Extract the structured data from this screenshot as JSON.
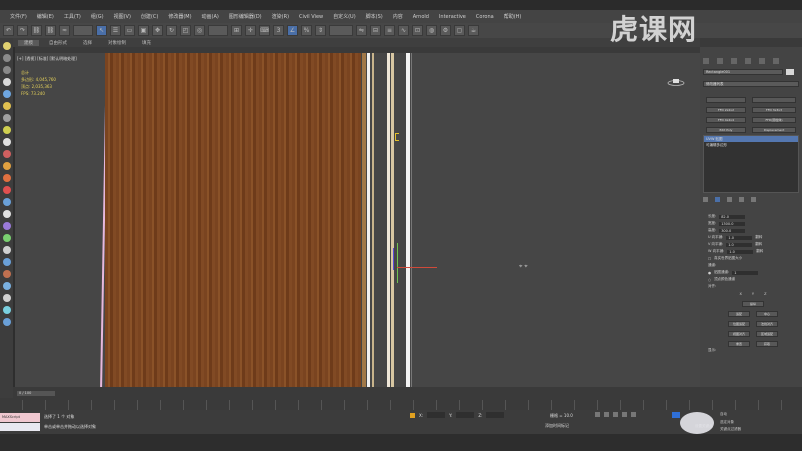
{
  "menu": [
    "文件(F)",
    "编辑(E)",
    "工具(T)",
    "组(G)",
    "视图(V)",
    "创建(C)",
    "修改器(M)",
    "动画(A)",
    "图形编辑器(D)",
    "渲染(R)",
    "Civil View",
    "自定义(U)",
    "脚本(S)",
    "内容",
    "Arnold",
    "Interactive",
    "Corona",
    "帮助(H)"
  ],
  "ribbon_tabs": [
    "建模",
    "自由形式",
    "选择",
    "对象绘制",
    "填充"
  ],
  "viewport": {
    "label": "[+] [透视] [标准] [默认明暗处理]",
    "stats": [
      "总计",
      "多边形: 4,045,760",
      "顶点: 2,035,363",
      "FPS: 73.240"
    ]
  },
  "command_panel": {
    "object_name": "Rectangle001",
    "modifier_list": "修改器列表",
    "buttons": [
      "",
      "",
      "FFD 2x2x2",
      "FFD 3x3x3",
      "FFD 4x4x4",
      "FFD(圆柱体)",
      "Edit Poly",
      "Displacement"
    ],
    "stack": [
      "UVW 贴图",
      "可编辑多边形"
    ],
    "params": [
      {
        "label": "长度:",
        "value": "82.0"
      },
      {
        "label": "宽度:",
        "value": "1300.0"
      },
      {
        "label": "高度:",
        "value": "300.0"
      },
      {
        "label": "U 向平铺:",
        "value": "1.0"
      },
      {
        "label": "V 向平铺:",
        "value": "1.0"
      },
      {
        "label": "W 向平铺:",
        "value": "1.0"
      }
    ],
    "flip_label": "翻转",
    "real_world": "真实世界贴图大小",
    "channel_title": "通道:",
    "channel_opt1": "贴图通道:",
    "channel_val": "1",
    "channel_opt2": "顶点颜色通道",
    "align_title": "对齐:",
    "align_xyz": [
      "X",
      "Y",
      "Z"
    ],
    "action_buttons": [
      "操纵",
      "适配",
      "中心",
      "位图适配",
      "法线对齐",
      "视图对齐",
      "区域适配",
      "重置",
      "获取"
    ],
    "display_title": "显示:"
  },
  "timeline": {
    "frame": "0 / 100"
  },
  "status": {
    "maxscript": "MAXScript",
    "selected": "选择了 1 个 对象",
    "hint": "单击或单击并拖动以选择对象",
    "x_label": "X:",
    "y_label": "Y:",
    "z_label": "Z:",
    "grid": "栅格 = 10.0",
    "add_tag": "添加时间标记",
    "auto": "自动",
    "selected_set": "选定对象",
    "set_key": "设置关键点",
    "key_filter": "关键点过滤器"
  },
  "watermark": "虎课网"
}
